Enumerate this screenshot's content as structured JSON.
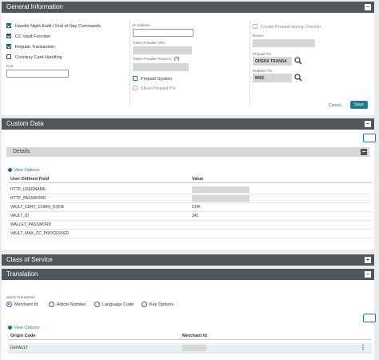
{
  "general": {
    "title": "General Information",
    "checkboxes": {
      "night_audit": "Handle Night Audit / End of Day Commands",
      "cc_vault": "CC Vault Function",
      "regular": "Regular Transaction",
      "courtesy": "Courtesy Card Handling"
    },
    "port_label": "Port",
    "ip_label": "IP Address",
    "token_url_label": "Token Provider URL",
    "token_protocol_label": "Token Provider Protocol",
    "prepaid_system": "Prepaid System",
    "show_prepaid_pin": "Show Prepaid Pin",
    "create_prepaid": "Create Prepaid during Checkin",
    "device_label": "Device",
    "prepaid_trx_label": "Prepaid Trx",
    "prepaid_trx_value": "OPERA TRANSA",
    "redeem_trx_label": "Redeem Trx",
    "redeem_trx_value": "8065",
    "cancel": "Cancel",
    "save": "Save"
  },
  "custom": {
    "title": "Custom Data",
    "details_title": "Details",
    "view_options": "View Options",
    "col_field": "User Defined Field",
    "col_value": "Value",
    "rows": [
      {
        "field": "HTTP_USERNAME",
        "value": ""
      },
      {
        "field": "HTTP_PASSWORD",
        "value": ""
      },
      {
        "field": "VAULT_CERT_CHAIN_CODE",
        "value": "CHA"
      },
      {
        "field": "VAULT_ID",
        "value": "341"
      },
      {
        "field": "WALLET_PASSWORD",
        "value": ""
      },
      {
        "field": "VAULT_MAX_CC_PROCESSED",
        "value": ""
      }
    ]
  },
  "class_of_service": {
    "title": "Class of Service"
  },
  "translation": {
    "title": "Translation",
    "select_label": "Select Translation",
    "radios": [
      "Merchant Id",
      "Article Number",
      "Language Code",
      "Key Options"
    ],
    "view_options": "View Options",
    "col_origin": "Origin Code",
    "col_merchant": "Merchant Id",
    "rows": [
      {
        "origin": "DEFAULT",
        "merchant": ""
      }
    ]
  }
}
